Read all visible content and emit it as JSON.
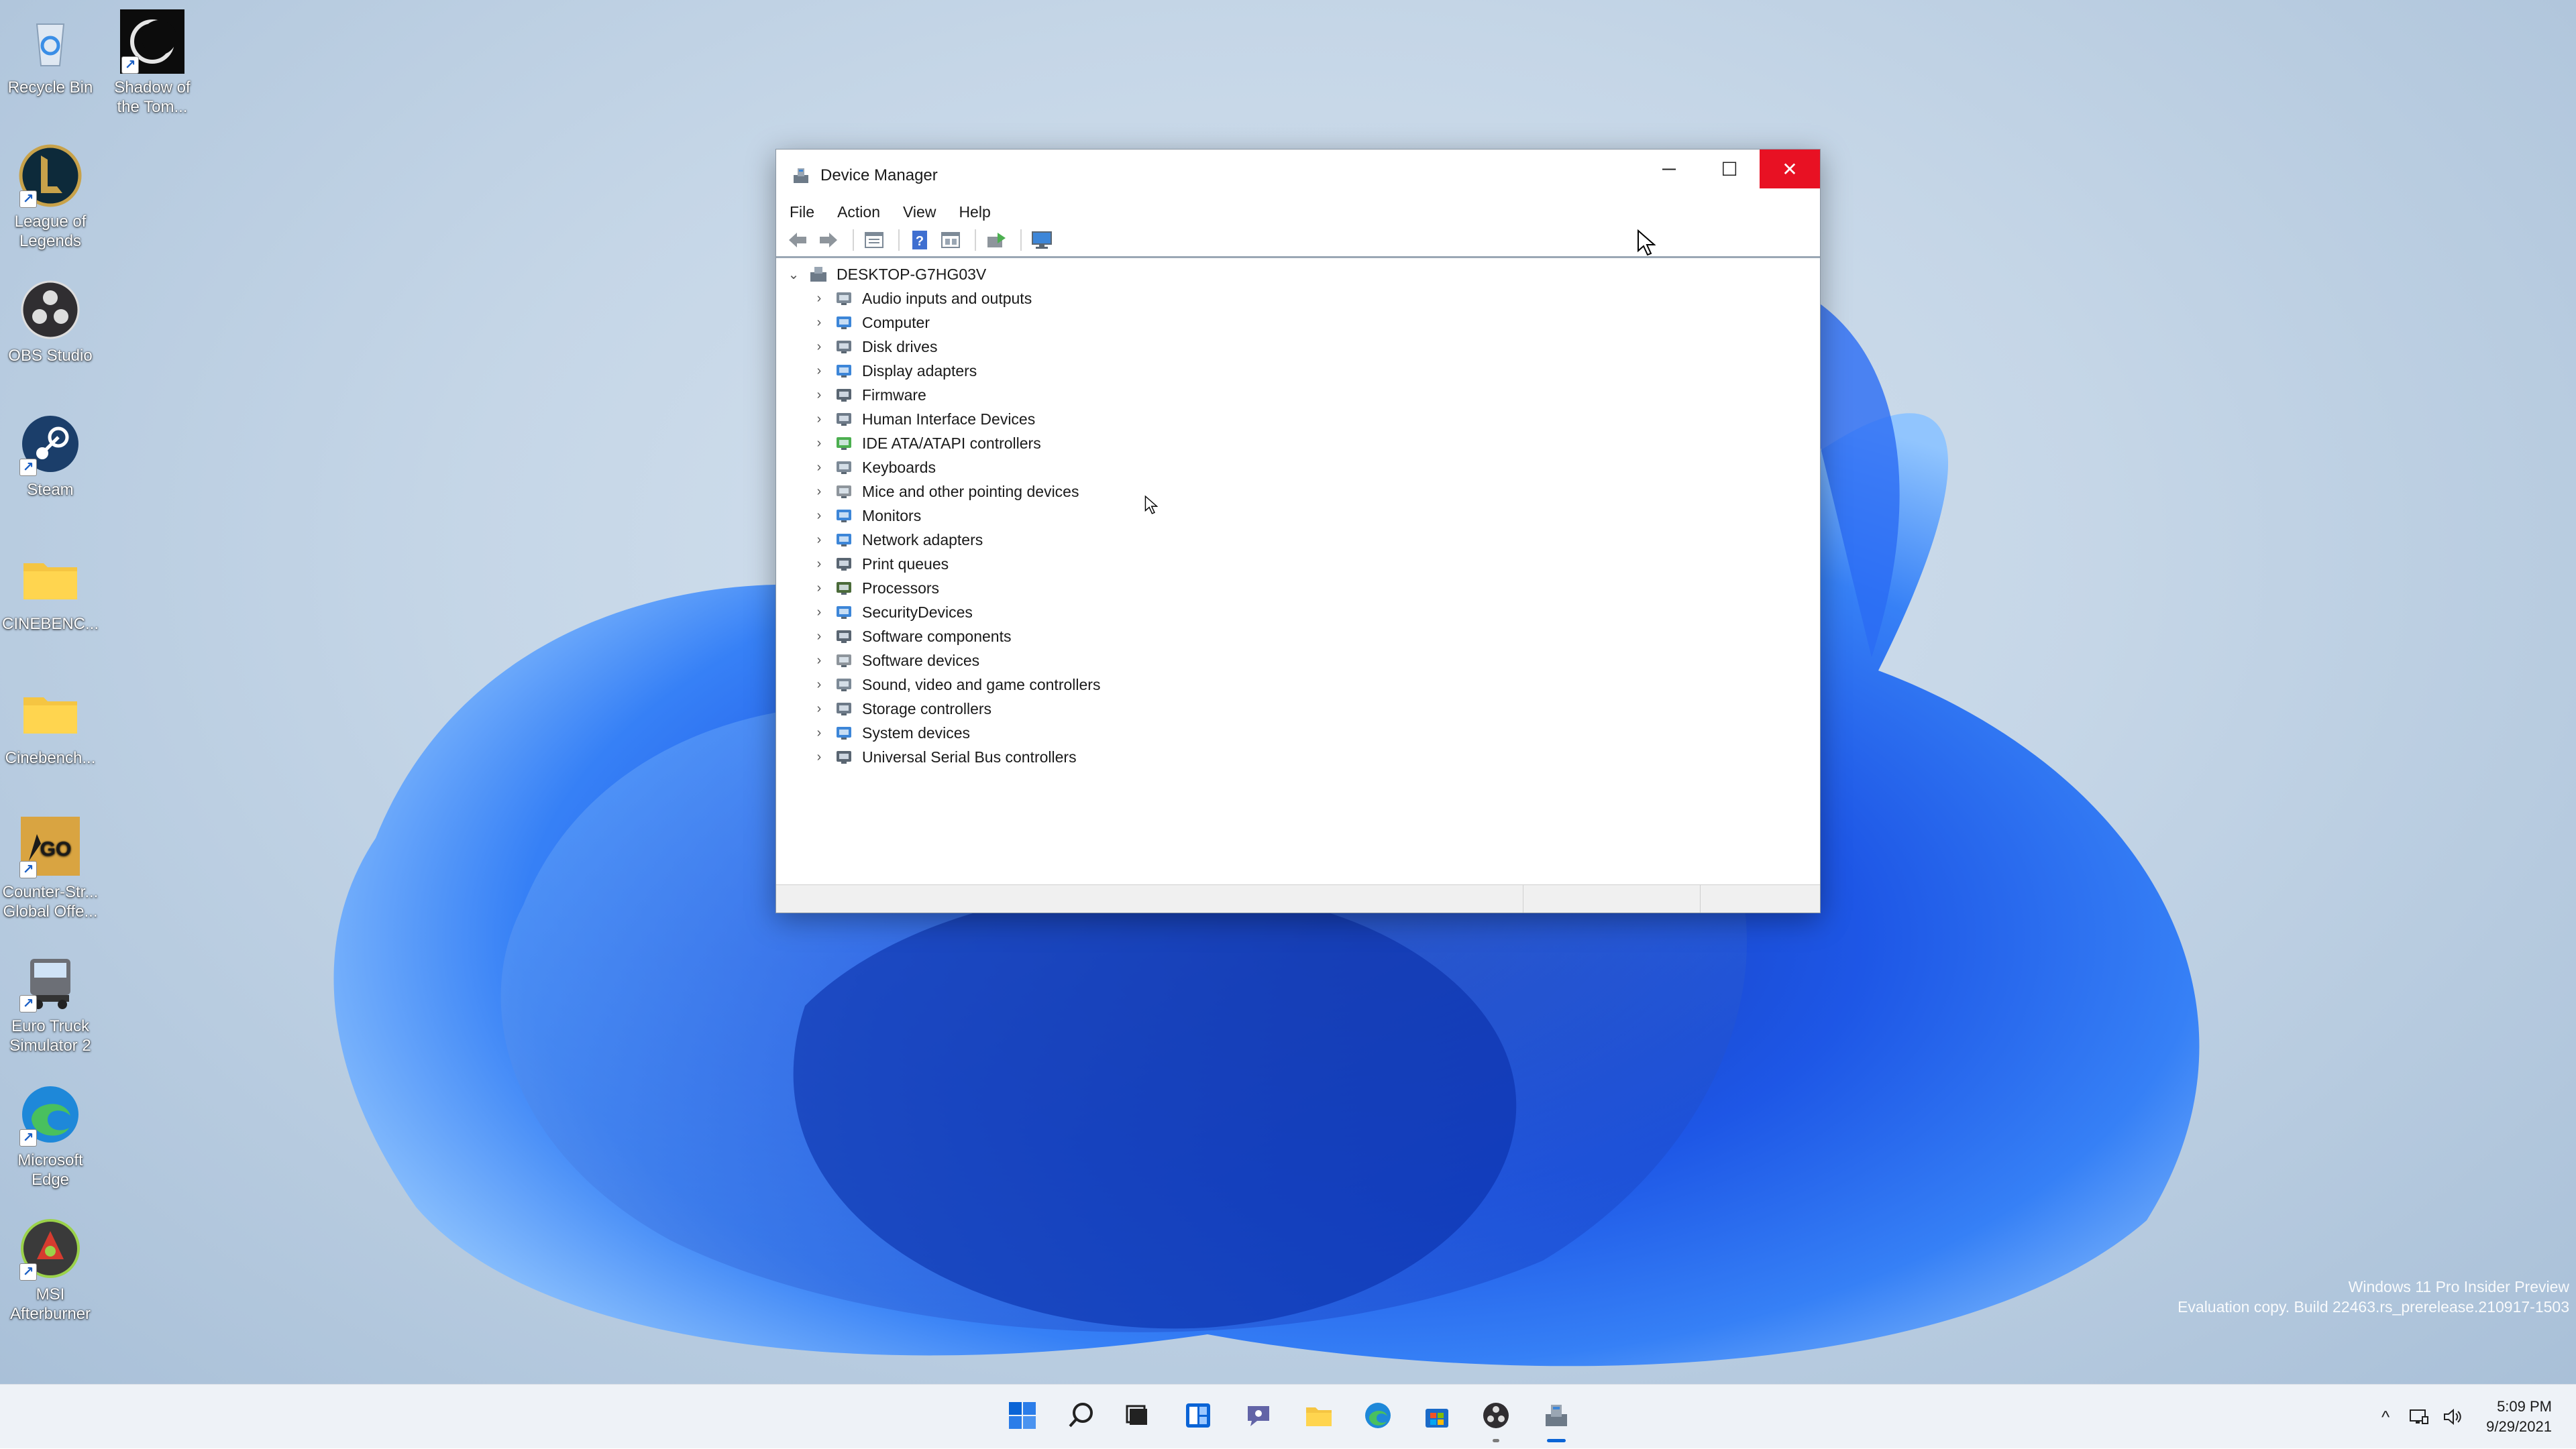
{
  "desktop": {
    "icons": [
      {
        "label": "Recycle Bin",
        "icon": "recycle-bin-icon"
      },
      {
        "label": "Shadow of the Tom...",
        "icon": "shadow-tomb-raider-icon"
      },
      {
        "label": "League of Legends",
        "icon": "league-of-legends-icon"
      },
      {
        "label": "OBS Studio",
        "icon": "obs-studio-icon"
      },
      {
        "label": "Steam",
        "icon": "steam-icon"
      },
      {
        "label": "CINEBENC...",
        "icon": "folder-icon"
      },
      {
        "label": "Cinebench...",
        "icon": "folder-icon"
      },
      {
        "label": "Counter-Str... Global Offe...",
        "icon": "csgo-icon"
      },
      {
        "label": "Euro Truck Simulator 2",
        "icon": "euro-truck-icon"
      },
      {
        "label": "Microsoft Edge",
        "icon": "edge-icon"
      },
      {
        "label": "MSI Afterburner",
        "icon": "msi-afterburner-icon"
      }
    ],
    "watermark": {
      "line1": "Windows 11 Pro Insider Preview",
      "line2": "Evaluation copy. Build 22463.rs_prerelease.210917-1503"
    }
  },
  "window": {
    "title": "Device Manager",
    "controls": {
      "minimize": "─",
      "maximize": "☐",
      "close": "✕"
    },
    "menu": [
      "File",
      "Action",
      "View",
      "Help"
    ],
    "toolbar": [
      "back-icon",
      "forward-icon",
      "properties-icon",
      "help-icon",
      "show-hidden-icon",
      "update-driver-icon",
      "scan-hardware-icon"
    ],
    "tree": {
      "root": "DESKTOP-G7HG03V",
      "items": [
        {
          "label": "Audio inputs and outputs",
          "icon": "speaker-icon"
        },
        {
          "label": "Computer",
          "icon": "computer-icon"
        },
        {
          "label": "Disk drives",
          "icon": "disk-drive-icon"
        },
        {
          "label": "Display adapters",
          "icon": "display-adapter-icon"
        },
        {
          "label": "Firmware",
          "icon": "firmware-icon"
        },
        {
          "label": "Human Interface Devices",
          "icon": "hid-icon"
        },
        {
          "label": "IDE ATA/ATAPI controllers",
          "icon": "ide-controller-icon"
        },
        {
          "label": "Keyboards",
          "icon": "keyboard-icon"
        },
        {
          "label": "Mice and other pointing devices",
          "icon": "mouse-icon"
        },
        {
          "label": "Monitors",
          "icon": "monitor-icon"
        },
        {
          "label": "Network adapters",
          "icon": "network-adapter-icon"
        },
        {
          "label": "Print queues",
          "icon": "printer-icon"
        },
        {
          "label": "Processors",
          "icon": "processor-icon"
        },
        {
          "label": "SecurityDevices",
          "icon": "security-device-icon"
        },
        {
          "label": "Software components",
          "icon": "software-component-icon"
        },
        {
          "label": "Software devices",
          "icon": "software-device-icon"
        },
        {
          "label": "Sound, video and game controllers",
          "icon": "sound-controller-icon"
        },
        {
          "label": "Storage controllers",
          "icon": "storage-controller-icon"
        },
        {
          "label": "System devices",
          "icon": "system-device-icon"
        },
        {
          "label": "Universal Serial Bus controllers",
          "icon": "usb-icon"
        }
      ]
    }
  },
  "taskbar": {
    "apps": [
      "start-icon",
      "search-icon",
      "task-view-icon",
      "widgets-icon",
      "chat-icon",
      "file-explorer-icon",
      "edge-icon",
      "store-icon",
      "obs-icon",
      "device-manager-icon"
    ],
    "tray": {
      "chevron": "^",
      "time": "5:09 PM",
      "date": "9/29/2021"
    }
  },
  "colors": {
    "accent": "#0a64d6",
    "close": "#e81123",
    "bloom": "#1a5cf0"
  }
}
